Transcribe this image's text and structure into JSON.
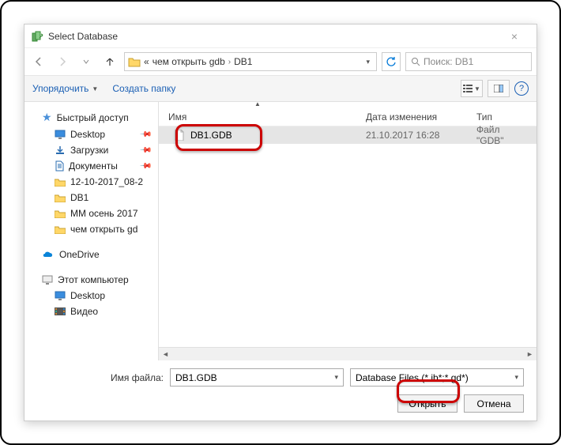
{
  "window": {
    "title": "Select Database"
  },
  "nav": {
    "crumb_prefix": "«",
    "crumb1": "чем открыть gdb",
    "crumb2": "DB1",
    "search_placeholder": "Поиск: DB1"
  },
  "toolbar": {
    "organize": "Упорядочить",
    "newfolder": "Создать папку"
  },
  "columns": {
    "name": "Имя",
    "date": "Дата изменения",
    "type": "Тип"
  },
  "sidebar": {
    "quick": "Быстрый доступ",
    "items": [
      {
        "label": "Desktop",
        "pin": true,
        "kind": "desktop"
      },
      {
        "label": "Загрузки",
        "pin": true,
        "kind": "downloads"
      },
      {
        "label": "Документы",
        "pin": true,
        "kind": "documents"
      },
      {
        "label": "12-10-2017_08-2",
        "kind": "folder"
      },
      {
        "label": "DB1",
        "kind": "folder"
      },
      {
        "label": "MM осень 2017",
        "kind": "folder"
      },
      {
        "label": "чем открыть gd",
        "kind": "folder"
      }
    ],
    "onedrive": "OneDrive",
    "thispc": "Этот компьютер",
    "pc_items": [
      {
        "label": "Desktop",
        "kind": "desktop"
      },
      {
        "label": "Видео",
        "kind": "video"
      }
    ]
  },
  "files": [
    {
      "name": "DB1.GDB",
      "date": "21.10.2017 16:28",
      "type": "Файл \"GDB\""
    }
  ],
  "bottom": {
    "filename_label": "Имя файла:",
    "filename_value": "DB1.GDB",
    "filter": "Database Files (*.ib*;*.gd*)",
    "open": "Открыть",
    "cancel": "Отмена"
  }
}
